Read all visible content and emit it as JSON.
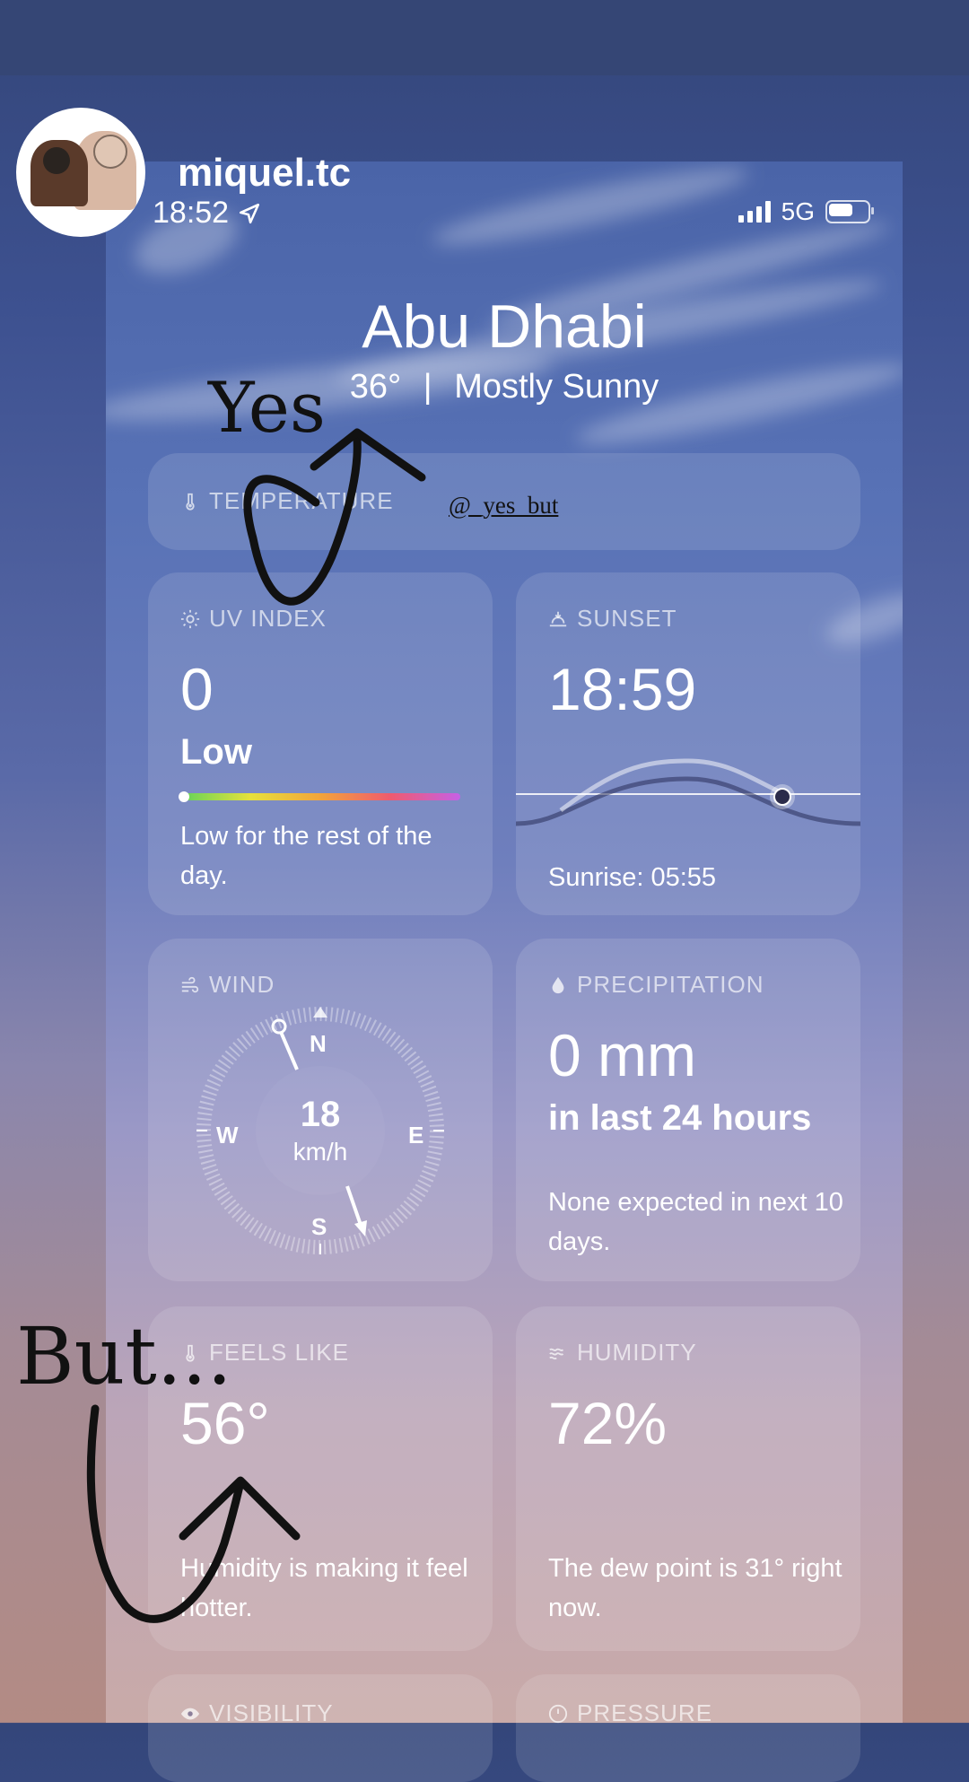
{
  "story": {
    "username": "miquel.tc",
    "handle": "@_yes_but"
  },
  "status_bar": {
    "time": "18:52",
    "network": "5G"
  },
  "location": {
    "city": "Abu Dhabi",
    "temperature": "36°",
    "separator": "|",
    "condition": "Mostly Sunny"
  },
  "cards": {
    "temperature": {
      "label": "TEMPERATURE"
    },
    "uv": {
      "label": "UV INDEX",
      "value": "0",
      "level": "Low",
      "desc": "Low for the rest of the day.",
      "scale_fraction": 0.0
    },
    "sunset": {
      "label": "SUNSET",
      "value": "18:59",
      "sunrise": "Sunrise: 05:55"
    },
    "wind": {
      "label": "WIND",
      "speed": "18",
      "unit": "km/h",
      "n": "N",
      "s": "S",
      "e": "E",
      "w": "W"
    },
    "precip": {
      "label": "PRECIPITATION",
      "value": "0 mm",
      "period": "in last 24 hours",
      "desc": "None expected in next 10 days."
    },
    "feels": {
      "label": "FEELS LIKE",
      "value": "56°",
      "desc": "Humidity is making it feel hotter."
    },
    "humidity": {
      "label": "HUMIDITY",
      "value": "72%",
      "desc": "The dew point is 31° right now."
    },
    "visibility": {
      "label": "VISIBILITY"
    },
    "pressure": {
      "label": "PRESSURE"
    }
  },
  "annotations": {
    "yes": "Yes",
    "but": "But..."
  },
  "icons": [
    "thermometer-icon",
    "sun-icon",
    "sunset-icon",
    "wind-icon",
    "droplet-icon",
    "humidity-icon",
    "eye-icon",
    "gauge-icon",
    "location-arrow-icon",
    "signal-icon",
    "battery-icon"
  ]
}
